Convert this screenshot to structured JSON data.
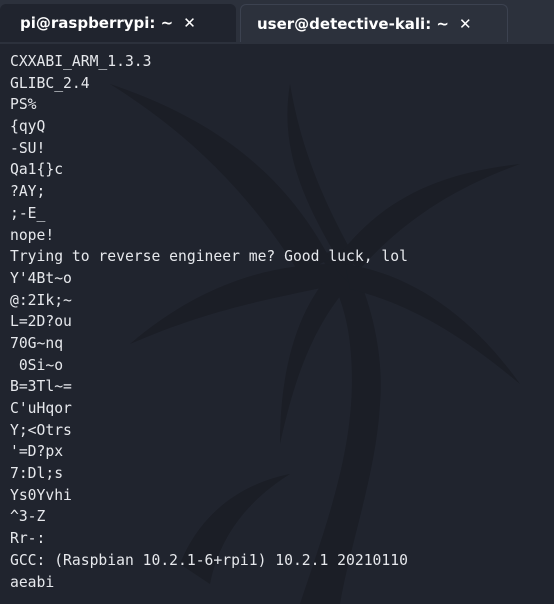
{
  "tabs": [
    {
      "title": "pi@raspberrypi: ~",
      "close_glyph": "✕",
      "active": true
    },
    {
      "title": "user@detective-kali: ~",
      "close_glyph": "✕",
      "active": false
    }
  ],
  "terminal": {
    "background_icon": "kali-dragon-icon",
    "lines": [
      "CXXABI_ARM_1.3.3",
      "GLIBC_2.4",
      "PS%",
      "{qyQ",
      "-SU!",
      "Qa1{}c",
      "?AY;",
      ";-E_",
      "nope!",
      "Trying to reverse engineer me? Good luck, lol",
      "Y'4Bt~o",
      "@:2Ik;~",
      "L=2D?ou",
      "70G~nq",
      " 0Si~o",
      "B=3Tl~=",
      "C'uHqor",
      "Y;<Otrs",
      "'=D?px",
      "7:Dl;s",
      "Ys0Yvhi",
      "^3-Z",
      "Rr-:",
      "GCC: (Raspbian 10.2.1-6+rpi1) 10.2.1 20210110",
      "aeabi"
    ]
  },
  "colors": {
    "terminal_bg": "#20242e",
    "tabbar_bg": "#2c313c",
    "text": "#e6e8ec"
  }
}
